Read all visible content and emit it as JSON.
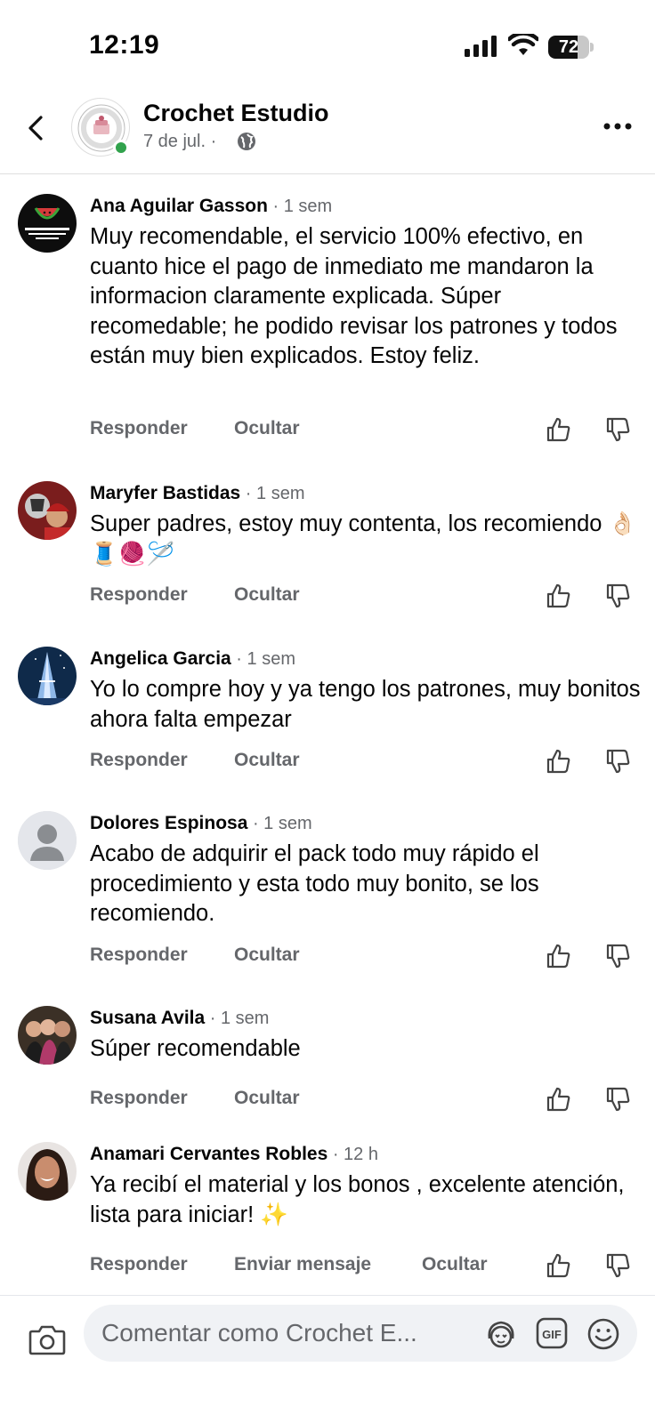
{
  "status_bar": {
    "time": "12:19",
    "battery": "72",
    "battery_level": 0.72
  },
  "header": {
    "page_name": "Crochet Estudio",
    "date": "7 de jul. ·"
  },
  "comments": [
    {
      "author": "Ana Aguilar Gasson",
      "meta": " · 1 sem",
      "text": "Muy recomendable, el servicio 100% efectivo, en cuanto hice el pago de inmediato me mandaron la informacion claramente explicada. Súper recomedable; he podido revisar los patrones y todos están muy bien explicados. Estoy feliz.",
      "reply": "Responder",
      "hide": "Ocultar"
    },
    {
      "author": "Maryfer Bastidas",
      "meta": " · 1 sem",
      "text": "Super padres, estoy muy contenta, los recomiendo 👌🏻🧵🧶🪡",
      "reply": "Responder",
      "hide": "Ocultar"
    },
    {
      "author": "Angelica Garcia",
      "meta": " · 1 sem",
      "text": "Yo lo compre hoy y ya tengo los patrones, muy bonitos ahora falta empezar",
      "reply": "Responder",
      "hide": "Ocultar"
    },
    {
      "author": "Dolores Espinosa",
      "meta": " · 1 sem",
      "text": "Acabo de adquirir el pack todo muy rápido el procedimiento y esta todo muy bonito, se los recomiendo.",
      "reply": "Responder",
      "hide": "Ocultar"
    },
    {
      "author": "Susana Avila",
      "meta": " · 1 sem",
      "text": "Súper recomendable",
      "reply": "Responder",
      "hide": "Ocultar"
    },
    {
      "author": "Anamari Cervantes Robles",
      "meta": " · 12 h",
      "text": "Ya recibí el material y los bonos ,  excelente atención, lista para iniciar! ✨",
      "reply": "Responder",
      "message": "Enviar mensaje",
      "hide": "Ocultar"
    }
  ],
  "composer": {
    "placeholder": "Comentar como Crochet E..."
  },
  "colors": {
    "online": "#31a24c",
    "secondary_text": "#65676b",
    "composer_bg": "#f0f2f5"
  },
  "icons": [
    "back-arrow-icon",
    "globe-icon",
    "more-icon",
    "like-icon",
    "dislike-icon",
    "camera-icon",
    "avatar-sticker-icon",
    "gif-icon",
    "emoji-icon"
  ]
}
